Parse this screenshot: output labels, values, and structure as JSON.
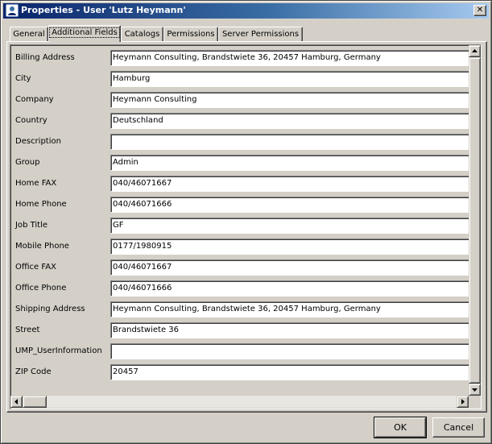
{
  "window": {
    "title": "Properties - User 'Lutz Heymann'",
    "close_glyph": "✕"
  },
  "tabs": [
    {
      "label": "General",
      "active": false
    },
    {
      "label": "Additional Fields",
      "active": true
    },
    {
      "label": "Catalogs",
      "active": false
    },
    {
      "label": "Permissions",
      "active": false
    },
    {
      "label": "Server Permissions",
      "active": false
    }
  ],
  "fields": [
    {
      "label": "Billing Address",
      "value": "Heymann Consulting, Brandstwiete 36, 20457 Hamburg, Germany"
    },
    {
      "label": "City",
      "value": "Hamburg"
    },
    {
      "label": "Company",
      "value": "Heymann Consulting"
    },
    {
      "label": "Country",
      "value": "Deutschland"
    },
    {
      "label": "Description",
      "value": ""
    },
    {
      "label": "Group",
      "value": "Admin"
    },
    {
      "label": "Home FAX",
      "value": "040/46071667"
    },
    {
      "label": "Home Phone",
      "value": "040/46071666"
    },
    {
      "label": "Job Title",
      "value": "GF"
    },
    {
      "label": "Mobile Phone",
      "value": "0177/1980915"
    },
    {
      "label": "Office FAX",
      "value": "040/46071667"
    },
    {
      "label": "Office Phone",
      "value": "040/46071666"
    },
    {
      "label": "Shipping Address",
      "value": "Heymann Consulting, Brandstwiete 36, 20457 Hamburg, Germany"
    },
    {
      "label": "Street",
      "value": "Brandstwiete 36"
    },
    {
      "label": "UMP_UserInformation",
      "value": ""
    },
    {
      "label": "ZIP Code",
      "value": "20457"
    }
  ],
  "buttons": {
    "ok": "OK",
    "cancel": "Cancel"
  },
  "colors": {
    "title_gradient_start": "#0a246a",
    "title_gradient_end": "#a6caf0",
    "face": "#d4d0c8"
  }
}
